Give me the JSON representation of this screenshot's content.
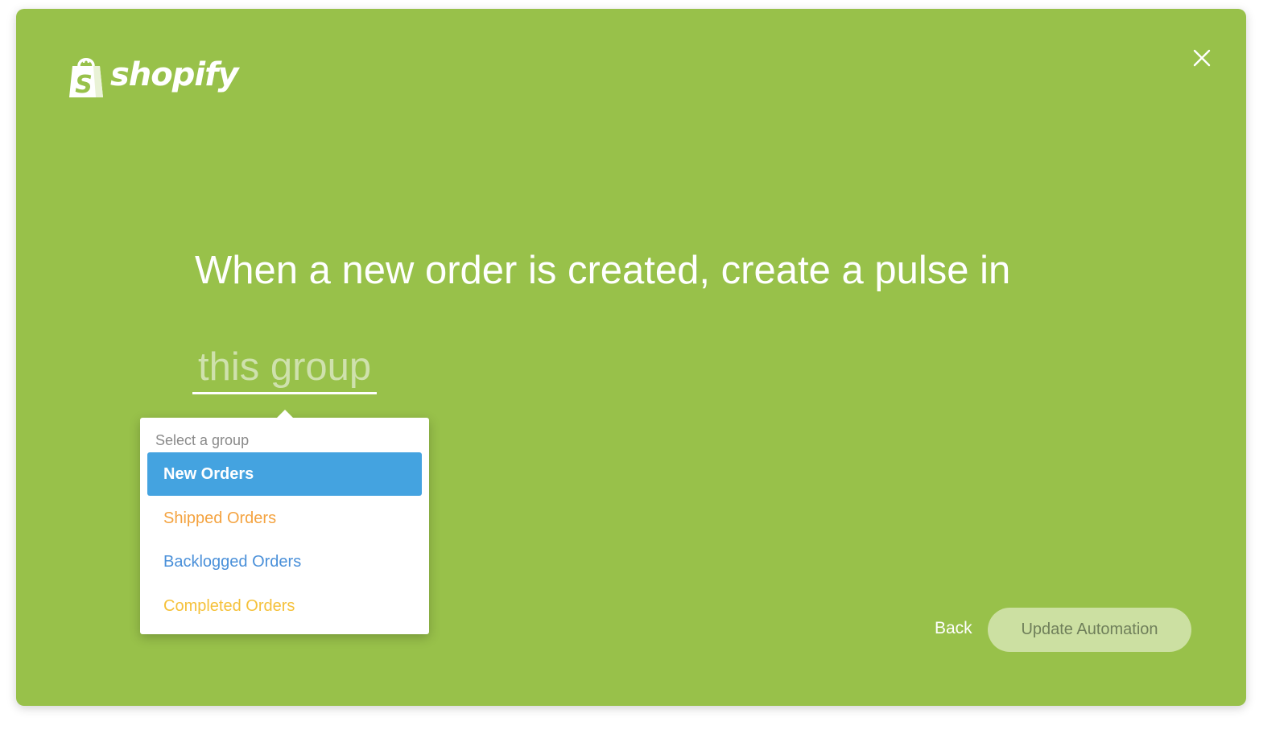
{
  "brand": {
    "name": "shopify",
    "icon": "shopify-bag-icon",
    "icon_letter": "S"
  },
  "close": {
    "icon": "close-icon",
    "glyph": "✕"
  },
  "automation": {
    "sentence": "When a new order is created, create a pulse in",
    "group_field_placeholder": "this group"
  },
  "dropdown": {
    "label": "Select a group",
    "options": [
      {
        "label": "New Orders",
        "color": "#ffffff",
        "selected": true
      },
      {
        "label": "Shipped Orders",
        "color": "#f4a340",
        "selected": false
      },
      {
        "label": "Backlogged Orders",
        "color": "#4a90d9",
        "selected": false
      },
      {
        "label": "Completed Orders",
        "color": "#f5c13a",
        "selected": false
      }
    ],
    "selected_background": "#44a3e0"
  },
  "footer": {
    "back_label": "Back",
    "update_label": "Update Automation"
  },
  "colors": {
    "background": "#98c14a",
    "field_placeholder": "#cfe1ad",
    "update_button_bg": "#cce0a2",
    "update_button_text": "#6f7f5a"
  }
}
